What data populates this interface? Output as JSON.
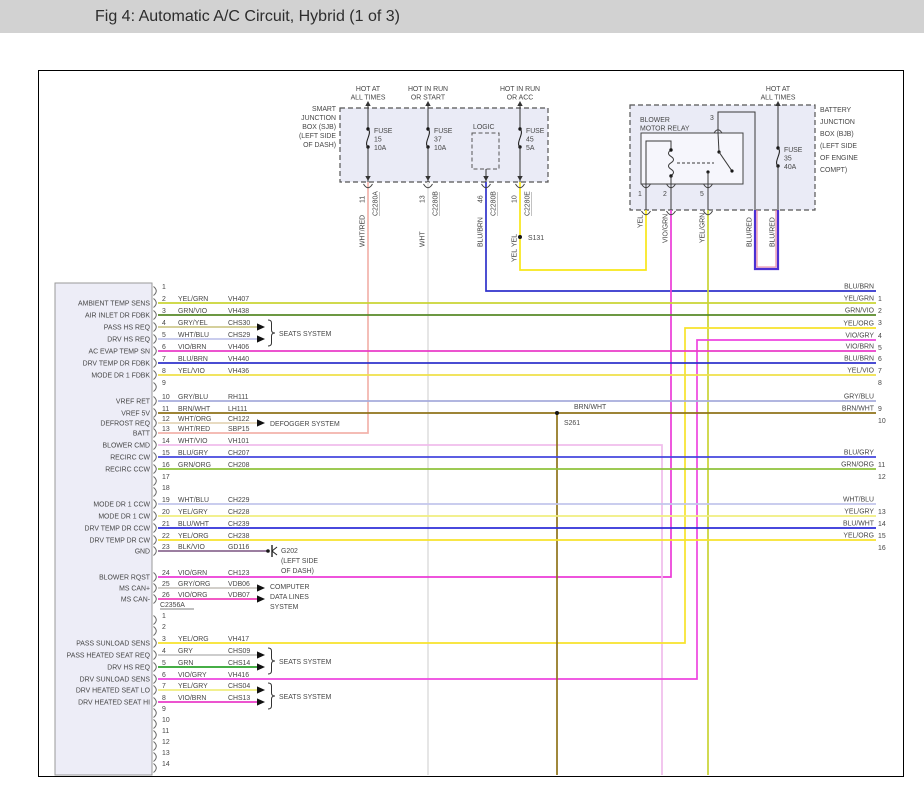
{
  "header": {
    "title": "Fig 4: Automatic A/C Circuit, Hybrid (1 of 3)"
  },
  "colors": {
    "YEL/GRN": "#c9d434",
    "GRN/VIO": "#578a28",
    "GRY/YEL": "#cfca8e",
    "WHT/BLU": "#c3c6ec",
    "VIO/BRN": "#e93bc8",
    "BLU/BRN": "#3032cb",
    "YEL/VIO": "#efe04a",
    "GRY/BLU": "#a6abdc",
    "BRN/WHT": "#8f7319",
    "WHT/ORG": "#e5d6b8",
    "WHT/RED": "#f2b3ab",
    "WHT/VIO": "#f0bdec",
    "BLU/GRY": "#4547de",
    "GRN/ORG": "#8fc23c",
    "YEL/GRY": "#f1ee7f",
    "BLU/WHT": "#2e2ed8",
    "YEL/ORG": "#f7e32b",
    "BLK/VIO": "#8d6b92",
    "VIO/GRN": "#ec3bd7",
    "GRY/ORG": "#cbc8c2",
    "VIO/ORG": "#f143bb",
    "YEL": "#f8e719",
    "VIO/GRY": "#ee46df",
    "WHT": "#e2e2e2",
    "GRY": "#c6c6c6",
    "GRN": "#2ba32b",
    "BLU/RED": "#4b2fd2",
    "BLU/RED_stripe": "#e87f9e"
  },
  "power_taps": [
    {
      "lines": [
        "HOT AT",
        "ALL TIMES"
      ]
    },
    {
      "lines": [
        "HOT IN RUN",
        "OR START"
      ]
    },
    {
      "lines": [
        "HOT IN RUN",
        "OR ACC"
      ]
    },
    {
      "lines": [
        "HOT AT",
        "ALL TIMES"
      ]
    }
  ],
  "sjb": {
    "label": [
      "SMART",
      "JUNCTION",
      "BOX (SJB)",
      "(LEFT SIDE",
      "OF DASH)"
    ],
    "fuses": [
      [
        "FUSE",
        "15",
        "10A"
      ],
      [
        "FUSE",
        "37",
        "10A"
      ],
      [
        "FUSE",
        "45",
        "5A"
      ]
    ],
    "logic": "LOGIC",
    "exits": [
      {
        "pin": "11",
        "conn": "C2280A",
        "wire": "WHT/RED"
      },
      {
        "pin": "13",
        "conn": "C2280B",
        "wire": "WHT"
      },
      {
        "pin": "46",
        "conn": "C2280B",
        "wire": "BLU/BRN"
      },
      {
        "pin": "10",
        "conn": "C2280E",
        "wire": "YEL"
      }
    ]
  },
  "bjb": {
    "label": [
      "BATTERY",
      "JUNCTION",
      "BOX (BJB)",
      "(LEFT SIDE",
      "OF ENGINE",
      "COMPT)"
    ],
    "relay": {
      "label": [
        "BLOWER",
        "MOTOR RELAY"
      ],
      "pins": [
        "1",
        "2",
        "5",
        "3"
      ]
    },
    "fuse": [
      "FUSE",
      "35",
      "40A"
    ],
    "wires": [
      "YEL",
      "VIO/GRN",
      "YEL/GRN",
      "BLU/RED",
      "BLU/RED"
    ]
  },
  "splices": {
    "s131": "S131",
    "s261": "S261",
    "s261_wire": "BRN/WHT",
    "s131_wire": "YEL"
  },
  "ground": {
    "name": "G202",
    "loc": [
      "(LEFT SIDE",
      "OF DASH)"
    ]
  },
  "systems": {
    "seats": "SEATS SYSTEM",
    "defogger": "DEFOGGER SYSTEM",
    "computer": [
      "COMPUTER",
      "DATA LINES",
      "SYSTEM"
    ]
  },
  "module": {
    "sections": [
      {
        "connector": "C2356A",
        "pins": [
          {
            "n": "1"
          },
          {
            "n": "2",
            "name": "AMBIENT TEMP SENS",
            "wire": "YEL/GRN",
            "circuit": "VH407"
          },
          {
            "n": "3",
            "name": "AIR INLET DR FDBK",
            "wire": "GRN/VIO",
            "circuit": "VH438"
          },
          {
            "n": "4",
            "name": "PASS HS REQ",
            "wire": "GRY/YEL",
            "circuit": "CHS30"
          },
          {
            "n": "5",
            "name": "DRV HS REQ",
            "wire": "WHT/BLU",
            "circuit": "CHS29"
          },
          {
            "n": "6",
            "name": "AC EVAP TEMP SN",
            "wire": "VIO/BRN",
            "circuit": "VH406"
          },
          {
            "n": "7",
            "name": "DRV TEMP DR FDBK",
            "wire": "BLU/BRN",
            "circuit": "VH440"
          },
          {
            "n": "8",
            "name": "MODE DR 1 FDBK",
            "wire": "YEL/VIO",
            "circuit": "VH436"
          },
          {
            "n": "9"
          },
          {
            "n": "10",
            "name": "VREF RET",
            "wire": "GRY/BLU",
            "circuit": "RH111"
          },
          {
            "n": "11",
            "name": "VREF 5V",
            "wire": "BRN/WHT",
            "circuit": "LH111"
          },
          {
            "n": "12",
            "name": "DEFROST REQ",
            "wire": "WHT/ORG",
            "circuit": "CH122"
          },
          {
            "n": "13",
            "name": "BATT",
            "wire": "WHT/RED",
            "circuit": "SBP15"
          },
          {
            "n": "14",
            "name": "BLOWER CMD",
            "wire": "WHT/VIO",
            "circuit": "VH101"
          },
          {
            "n": "15",
            "name": "RECIRC CW",
            "wire": "BLU/GRY",
            "circuit": "CH207"
          },
          {
            "n": "16",
            "name": "RECIRC CCW",
            "wire": "GRN/ORG",
            "circuit": "CH208"
          },
          {
            "n": "17"
          },
          {
            "n": "18"
          },
          {
            "n": "19",
            "name": "MODE DR 1 CCW",
            "wire": "WHT/BLU",
            "circuit": "CH229"
          },
          {
            "n": "20",
            "name": "MODE DR 1 CW",
            "wire": "YEL/GRY",
            "circuit": "CH228"
          },
          {
            "n": "21",
            "name": "DRV TEMP DR CCW",
            "wire": "BLU/WHT",
            "circuit": "CH239"
          },
          {
            "n": "22",
            "name": "DRV TEMP DR CW",
            "wire": "YEL/ORG",
            "circuit": "CH238"
          },
          {
            "n": "23",
            "name": "GND",
            "wire": "BLK/VIO",
            "circuit": "GD116"
          },
          {
            "n": "24",
            "name": "BLOWER RQST",
            "wire": "VIO/GRN",
            "circuit": "CH123"
          },
          {
            "n": "25",
            "name": "MS CAN+",
            "wire": "GRY/ORG",
            "circuit": "VDB06"
          },
          {
            "n": "26",
            "name": "MS CAN-",
            "wire": "VIO/ORG",
            "circuit": "VDB07"
          }
        ]
      },
      {
        "connector": "",
        "pins": [
          {
            "n": "1"
          },
          {
            "n": "2"
          },
          {
            "n": "3",
            "name": "PASS SUNLOAD SENS",
            "wire": "YEL/ORG",
            "circuit": "VH417"
          },
          {
            "n": "4",
            "name": "PASS HEATED SEAT REQ",
            "wire": "GRY",
            "circuit": "CHS09"
          },
          {
            "n": "5",
            "name": "DRV HS REQ",
            "wire": "GRN",
            "circuit": "CHS14"
          },
          {
            "n": "6",
            "name": "DRV SUNLOAD SENS",
            "wire": "VIO/GRY",
            "circuit": "VH416"
          },
          {
            "n": "7",
            "name": "DRV HEATED SEAT LO",
            "wire": "YEL/GRY",
            "circuit": "CHS04"
          },
          {
            "n": "8",
            "name": "DRV HEATED SEAT HI",
            "wire": "VIO/BRN",
            "circuit": "CHS13"
          },
          {
            "n": "9"
          },
          {
            "n": "10"
          },
          {
            "n": "11"
          },
          {
            "n": "12"
          },
          {
            "n": "13"
          },
          {
            "n": "14"
          }
        ]
      }
    ]
  },
  "right_edge": [
    [
      "1",
      "BLU/BRN"
    ],
    [
      "2",
      "YEL/GRN"
    ],
    [
      "3",
      "GRN/VIO"
    ],
    [
      "4",
      "YEL/ORG"
    ],
    [
      "5",
      "VIO/GRY"
    ],
    [
      "6",
      "VIO/BRN"
    ],
    [
      "7",
      "BLU/BRN"
    ],
    [
      "8",
      "YEL/VIO"
    ],
    [
      "9",
      "GRY/BLU"
    ],
    [
      "10",
      "BRN/WHT"
    ],
    [
      "11",
      "BLU/GRY"
    ],
    [
      "12",
      "GRN/ORG"
    ],
    [
      "13",
      "WHT/BLU"
    ],
    [
      "14",
      "YEL/GRY"
    ],
    [
      "15",
      "BLU/WHT"
    ],
    [
      "16",
      "YEL/ORG"
    ]
  ]
}
